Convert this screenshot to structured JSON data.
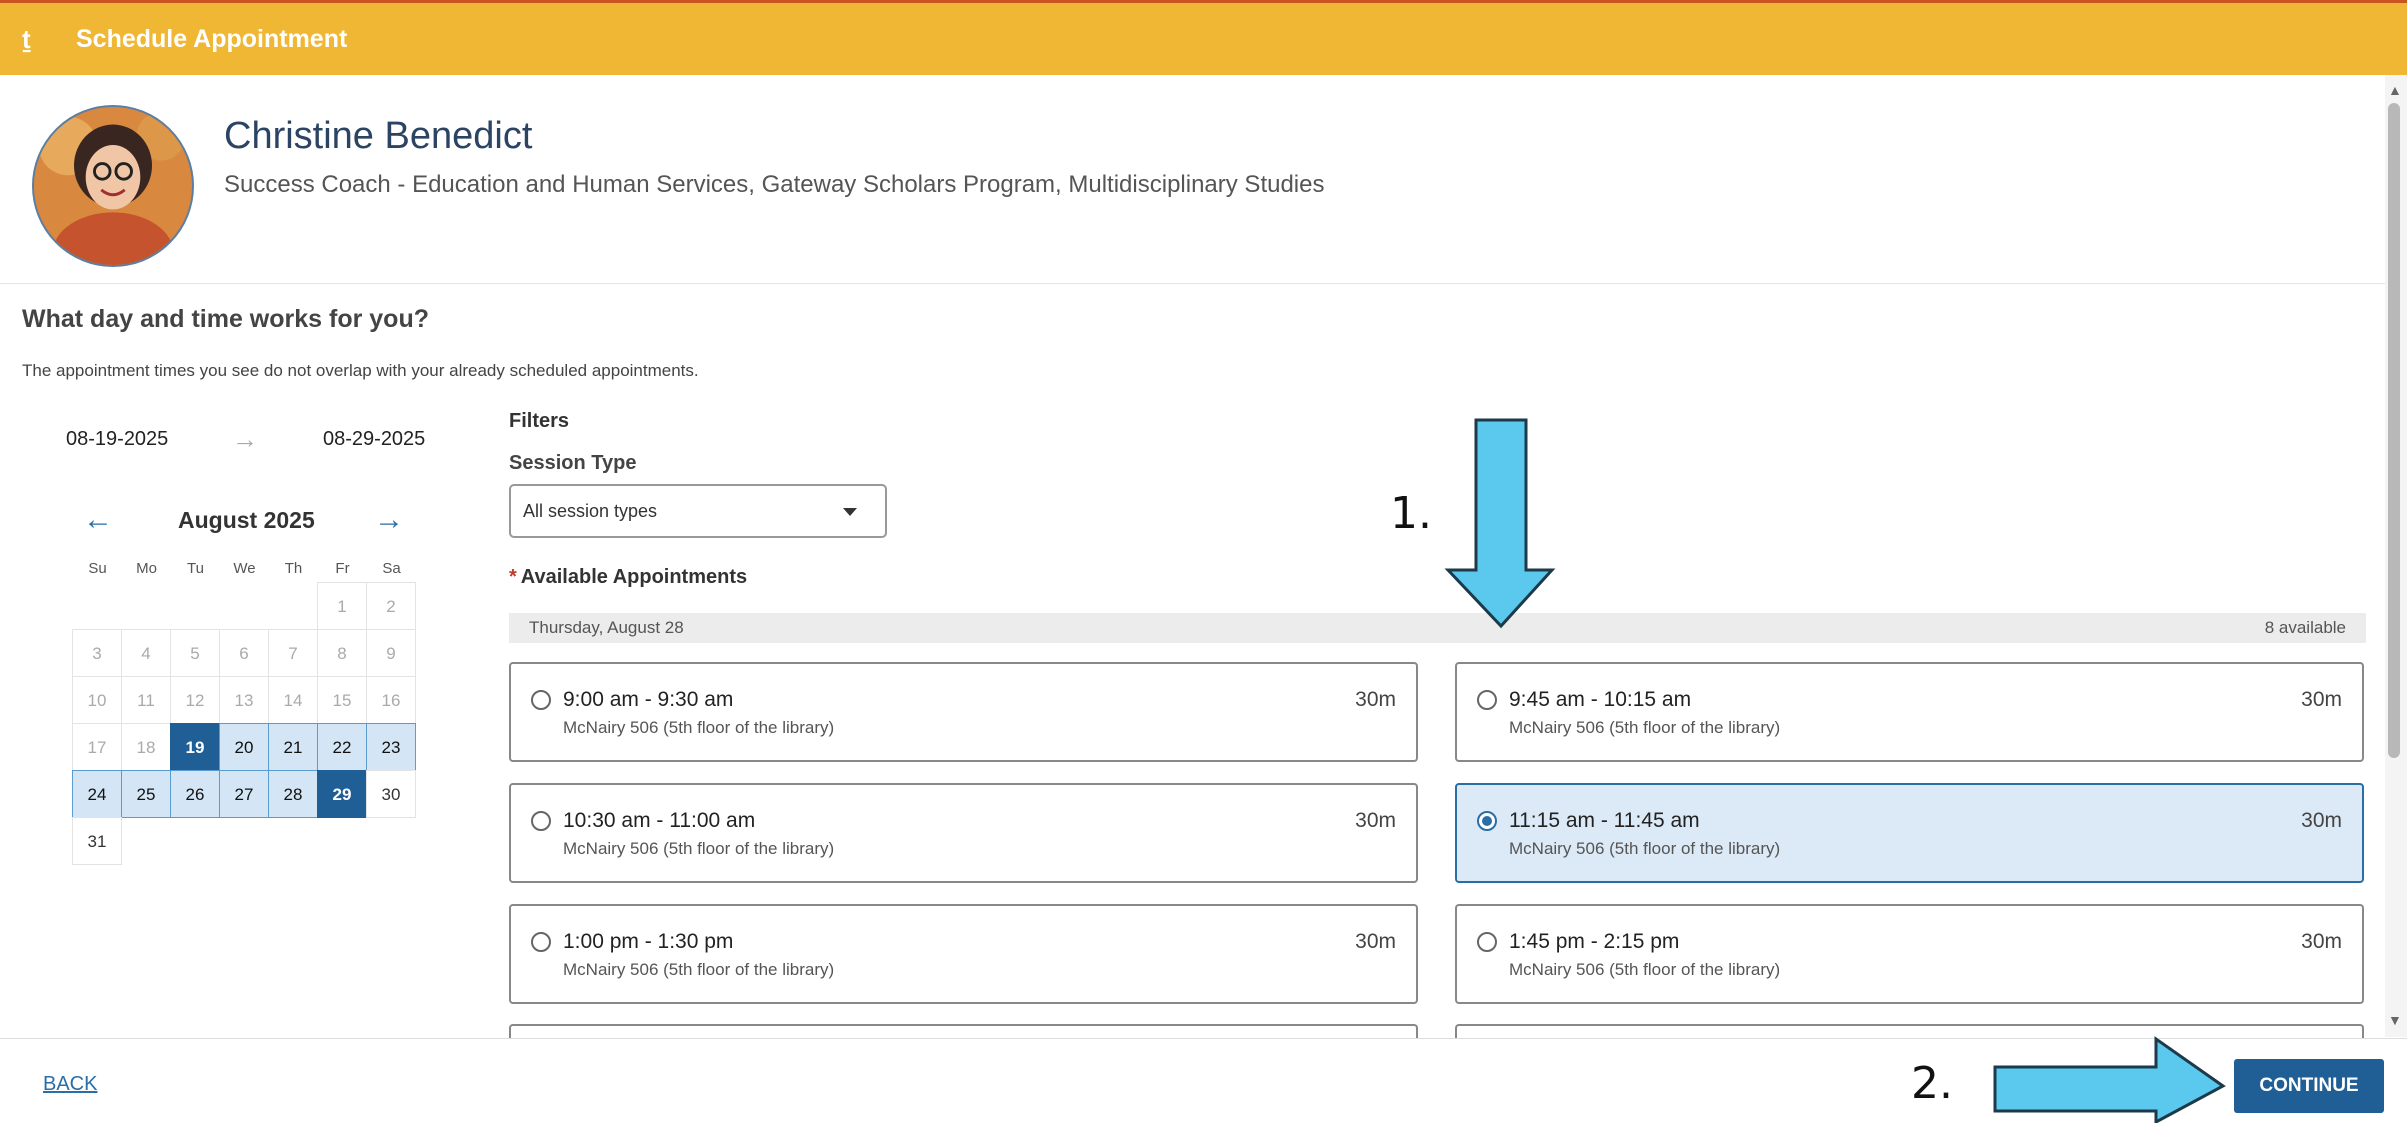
{
  "header": {
    "title": "Schedule Appointment",
    "back_glyph": "ṯ"
  },
  "profile": {
    "name": "Christine Benedict",
    "role": "Success Coach - Education and Human Services, Gateway Scholars Program, Multidisciplinary Studies"
  },
  "question": "What day and time works for you?",
  "note": "The appointment times you see do not overlap with your already scheduled appointments.",
  "date_range": {
    "from": "08-19-2025",
    "to": "08-29-2025",
    "arrow": "→"
  },
  "calendar": {
    "title": "August 2025",
    "prev": "←",
    "next": "→",
    "weekdays": [
      "Su",
      "Mo",
      "Tu",
      "We",
      "Th",
      "Fr",
      "Sa"
    ],
    "leading_blanks": 5,
    "days": [
      {
        "d": "1",
        "s": "past"
      },
      {
        "d": "2",
        "s": "past"
      },
      {
        "d": "3",
        "s": "past"
      },
      {
        "d": "4",
        "s": "past"
      },
      {
        "d": "5",
        "s": "past"
      },
      {
        "d": "6",
        "s": "past"
      },
      {
        "d": "7",
        "s": "past"
      },
      {
        "d": "8",
        "s": "past"
      },
      {
        "d": "9",
        "s": "past"
      },
      {
        "d": "10",
        "s": "past"
      },
      {
        "d": "11",
        "s": "past"
      },
      {
        "d": "12",
        "s": "past"
      },
      {
        "d": "13",
        "s": "past"
      },
      {
        "d": "14",
        "s": "past"
      },
      {
        "d": "15",
        "s": "past"
      },
      {
        "d": "16",
        "s": "past"
      },
      {
        "d": "17",
        "s": "past"
      },
      {
        "d": "18",
        "s": "past"
      },
      {
        "d": "19",
        "s": "selected"
      },
      {
        "d": "20",
        "s": "avail"
      },
      {
        "d": "21",
        "s": "avail"
      },
      {
        "d": "22",
        "s": "avail"
      },
      {
        "d": "23",
        "s": "avail"
      },
      {
        "d": "24",
        "s": "avail"
      },
      {
        "d": "25",
        "s": "avail"
      },
      {
        "d": "26",
        "s": "avail"
      },
      {
        "d": "27",
        "s": "avail"
      },
      {
        "d": "28",
        "s": "avail"
      },
      {
        "d": "29",
        "s": "selected"
      },
      {
        "d": "30",
        "s": "normal"
      },
      {
        "d": "31",
        "s": "normal"
      }
    ]
  },
  "filters": {
    "title": "Filters",
    "session_type_label": "Session Type",
    "session_type_value": "All session types"
  },
  "appointments": {
    "label": "Available Appointments",
    "required_mark": "*",
    "day_label": "Thursday, August 28",
    "count": "8 available",
    "slots": [
      {
        "time": "9:00 am - 9:30 am",
        "duration": "30m",
        "location": "McNairy 506 (5th floor of the library)",
        "selected": false
      },
      {
        "time": "9:45 am - 10:15 am",
        "duration": "30m",
        "location": "McNairy 506 (5th floor of the library)",
        "selected": false
      },
      {
        "time": "10:30 am - 11:00 am",
        "duration": "30m",
        "location": "McNairy 506 (5th floor of the library)",
        "selected": false
      },
      {
        "time": "11:15 am - 11:45 am",
        "duration": "30m",
        "location": "McNairy 506 (5th floor of the library)",
        "selected": true
      },
      {
        "time": "1:00 pm - 1:30 pm",
        "duration": "30m",
        "location": "McNairy 506 (5th floor of the library)",
        "selected": false
      },
      {
        "time": "1:45 pm - 2:15 pm",
        "duration": "30m",
        "location": "McNairy 506 (5th floor of the library)",
        "selected": false
      }
    ]
  },
  "footer": {
    "back_label": "BACK",
    "continue_label": "CONTINUE"
  },
  "annotations": {
    "step1": "1.",
    "step2": "2.",
    "arrow_color": "#5bc8ee"
  },
  "colors": {
    "header": "#efb733",
    "primary": "#1f5f96",
    "avail_day": "#d4e6f6",
    "selected_slot": "#dce9f6"
  },
  "icons": {
    "back": "back-arrow-icon",
    "dropdown": "caret-down-icon",
    "prev": "arrow-left-icon",
    "next": "arrow-right-icon"
  }
}
